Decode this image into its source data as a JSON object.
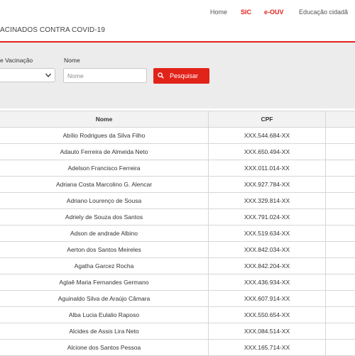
{
  "nav": {
    "home": "Home",
    "sic": "SIC",
    "eouv": "e-OUV",
    "educacao": "Educação cidadã"
  },
  "page_title": "ACINADOS CONTRA COVID-19",
  "filters": {
    "vacinacao_label": "e Vacinação",
    "nome_label": "Nome",
    "nome_placeholder": "Nome",
    "pesquisar_label": "Pesquisar"
  },
  "table": {
    "headers": [
      "Nome",
      "CPF"
    ],
    "rows": [
      {
        "nome": "Abílio Rodrigues da Silva Filho",
        "cpf": "XXX.544.684-XX"
      },
      {
        "nome": "Adauto Ferreira de Almeida Neto",
        "cpf": "XXX.650.494-XX"
      },
      {
        "nome": "Adelson Francisco Ferreira",
        "cpf": "XXX.011.014-XX"
      },
      {
        "nome": "Adriana Costa Marcolino G. Alencar",
        "cpf": "XXX.927.784-XX"
      },
      {
        "nome": "Adriano Lourenço de Sousa",
        "cpf": "XXX.329.814-XX"
      },
      {
        "nome": "Adriely de Souza dos Santos",
        "cpf": "XXX.791.024-XX"
      },
      {
        "nome": "Adson de andrade Albino",
        "cpf": "XXX.519.634-XX"
      },
      {
        "nome": "Aerton dos Santos Meireles",
        "cpf": "XXX.842.034-XX"
      },
      {
        "nome": "Agatha Garcez Rocha",
        "cpf": "XXX.842.204-XX"
      },
      {
        "nome": "Aglaê Maria Fernandes Germano",
        "cpf": "XXX.436.934-XX"
      },
      {
        "nome": "Aguinaldo Silva de Araújo Câmara",
        "cpf": "XXX.607.914-XX"
      },
      {
        "nome": "Alba Lucia Eulalio Raposo",
        "cpf": "XXX.550.654-XX"
      },
      {
        "nome": "Alcides de Assis Lira Neto",
        "cpf": "XXX.084.514-XX"
      },
      {
        "nome": "Alcione dos Santos Pessoa",
        "cpf": "XXX.165.714-XX"
      }
    ]
  },
  "colors": {
    "accent": "#e2231a",
    "filter_bg": "#ececec",
    "header_bg": "#f2f2f2"
  },
  "icons": {
    "select": "chevron-down-icon",
    "search": "search-icon"
  }
}
